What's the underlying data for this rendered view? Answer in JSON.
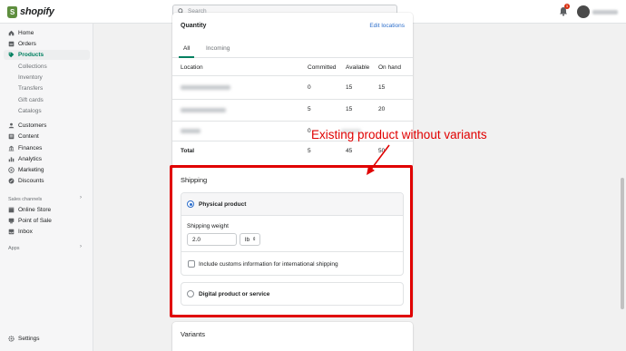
{
  "topbar": {
    "logo_text": "shopify",
    "search_placeholder": "Search",
    "notification_count": "1"
  },
  "sidebar": {
    "items": [
      {
        "label": "Home"
      },
      {
        "label": "Orders"
      },
      {
        "label": "Products"
      },
      {
        "label": "Customers"
      },
      {
        "label": "Content"
      },
      {
        "label": "Finances"
      },
      {
        "label": "Analytics"
      },
      {
        "label": "Marketing"
      },
      {
        "label": "Discounts"
      }
    ],
    "product_sub": [
      "Collections",
      "Inventory",
      "Transfers",
      "Gift cards",
      "Catalogs"
    ],
    "sales_channels_label": "Sales channels",
    "channels": [
      "Online Store",
      "Point of Sale",
      "Inbox"
    ],
    "apps_label": "Apps",
    "settings_label": "Settings"
  },
  "quantity": {
    "title": "Quantity",
    "edit_link": "Edit locations",
    "tabs": [
      "All",
      "Incoming"
    ],
    "headers": [
      "Location",
      "Committed",
      "Available",
      "On hand"
    ],
    "rows": [
      {
        "committed": "0",
        "available": "15",
        "on_hand": "15"
      },
      {
        "committed": "5",
        "available": "15",
        "on_hand": "20"
      },
      {
        "committed": "0",
        "available": "",
        "on_hand": ""
      }
    ],
    "total": {
      "label": "Total",
      "committed": "5",
      "available": "45",
      "on_hand": "50"
    }
  },
  "shipping": {
    "title": "Shipping",
    "physical_label": "Physical product",
    "weight_label": "Shipping weight",
    "weight_value": "2.0",
    "unit": "lb",
    "customs_label": "Include customs information for international shipping",
    "digital_label": "Digital product or service"
  },
  "variants": {
    "title": "Variants"
  },
  "annotation": {
    "text": "Existing product without variants",
    "color": "#e00000"
  },
  "colors": {
    "brand_green": "#008060",
    "link_blue": "#2c6ecb",
    "annotation_red": "#e00000"
  }
}
